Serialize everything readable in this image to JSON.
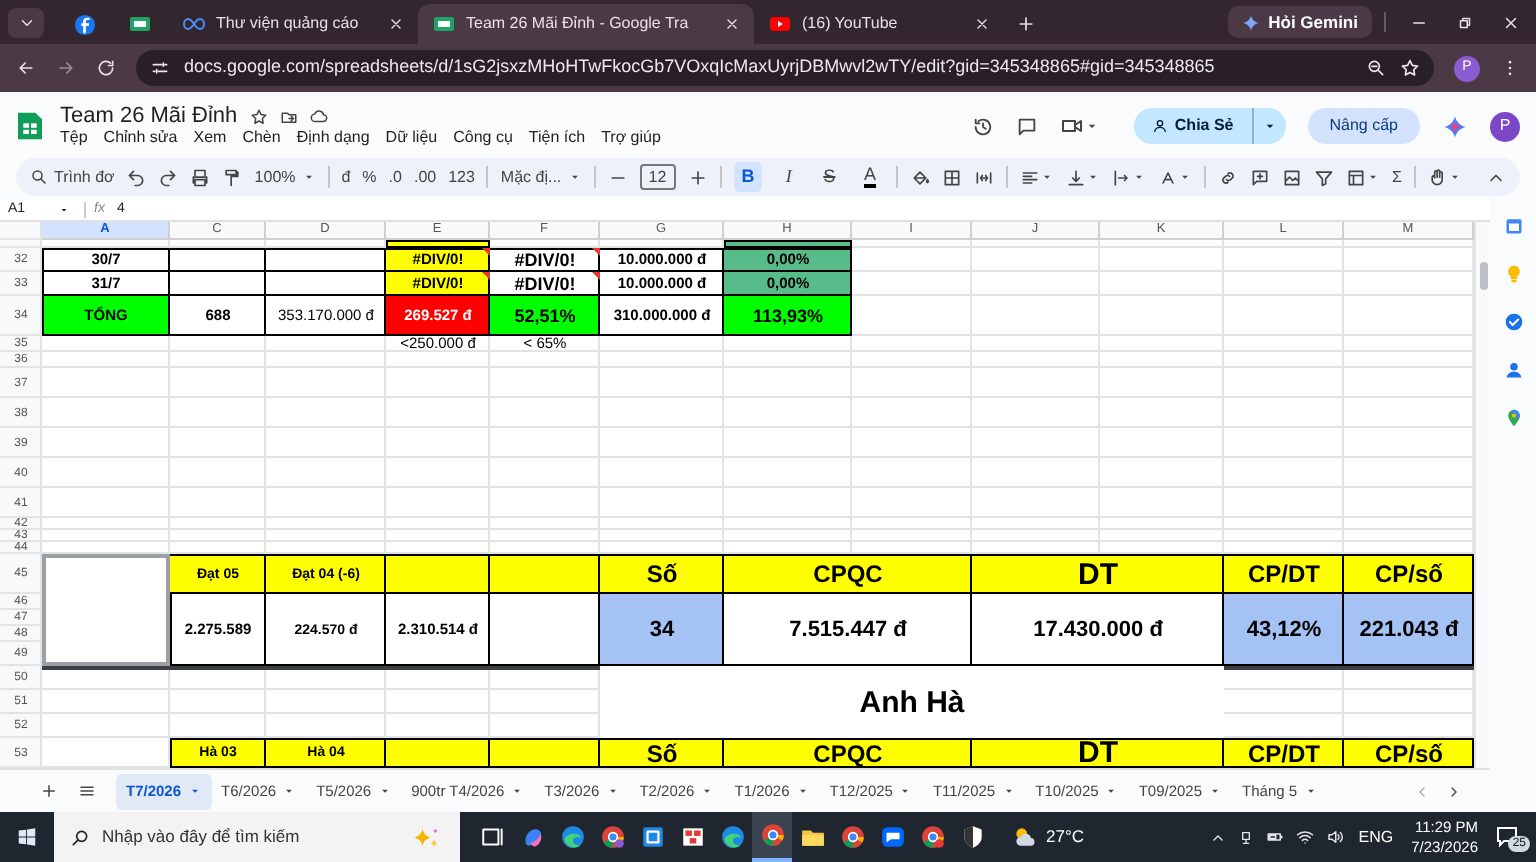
{
  "browser": {
    "tabs": [
      {
        "kind": "circle",
        "selected": false
      },
      {
        "kind": "sheet",
        "selected": false
      },
      {
        "kind": "loop",
        "title": "Thư viện quảng cáo",
        "selected": false
      },
      {
        "kind": "sheet",
        "title": "Team 26 Mãi Đỉnh - Google Tra",
        "selected": true
      },
      {
        "kind": "play",
        "title": "(16) YouTube",
        "selected": false
      }
    ],
    "gemini": "Hỏi Gemini",
    "url": "docs.google.com/spreadsheets/d/1sG2jsxzMHoHTwFkocGb7VOxqIcMaxUyrjDBMwvl2wTY/edit?gid=345348865#gid=345348865",
    "profile": "P"
  },
  "app": {
    "title": "Team 26 Mãi Đỉnh",
    "menu": [
      "Tệp",
      "Chỉnh sửa",
      "Xem",
      "Chèn",
      "Định dạng",
      "Dữ liệu",
      "Công cụ",
      "Tiện ích",
      "Trợ giúp"
    ],
    "share": "Chia Sẻ",
    "upgrade": "Nâng cấp",
    "avatar": "P"
  },
  "toolbar": [
    {
      "kind": "search",
      "text": "Trình đơ"
    },
    {
      "kind": "dropdown",
      "text": "100%"
    },
    {
      "kind": "button",
      "text": "đ"
    },
    {
      "kind": "button",
      "text": "%"
    },
    {
      "kind": "button",
      "text": ".0"
    },
    {
      "kind": "button",
      "text": ".00"
    },
    {
      "kind": "button",
      "text": "123"
    },
    {
      "kind": "dropdown",
      "text": "Mặc đị..."
    },
    {
      "kind": "field",
      "text": "12"
    },
    {
      "kind": "toggle",
      "text": "B",
      "selected": true
    },
    {
      "kind": "toggle",
      "text": "I",
      "selected": false
    },
    {
      "kind": "toggle",
      "text": "S",
      "selected": false
    },
    {
      "kind": "toggle",
      "text": "A",
      "selected": false
    },
    {
      "kind": "button",
      "text": "Σ"
    }
  ],
  "formula_bar": {
    "cell": "A1",
    "fx": "fx",
    "value": "4"
  },
  "sheet": {
    "columns": [
      {
        "label": "A",
        "selected": true
      },
      {
        "label": "C",
        "selected": false
      },
      {
        "label": "D",
        "selected": false
      },
      {
        "label": "E",
        "selected": false
      },
      {
        "label": "F",
        "selected": false
      },
      {
        "label": "G",
        "selected": false
      },
      {
        "label": "H",
        "selected": false
      },
      {
        "label": "I",
        "selected": false
      },
      {
        "label": "J",
        "selected": false
      },
      {
        "label": "K",
        "selected": false
      },
      {
        "label": "L",
        "selected": false
      },
      {
        "label": "M",
        "selected": false
      }
    ],
    "rows": [
      {
        "cells": [
          {
            "color": "#ffff00"
          },
          {
            "color": "#57bb8a"
          }
        ]
      },
      {
        "number": "32",
        "cells": [
          {
            "text": "30/7",
            "kind": "bold"
          },
          {},
          {},
          {
            "text": "#DIV/0!",
            "kind": "bold",
            "color": "#ffff00",
            "error": true
          },
          {
            "text": "#DIV/0!",
            "kind": "strong",
            "error": true
          },
          {
            "text": "10.000.000 đ",
            "kind": "bold"
          },
          {
            "text": "0,00%",
            "kind": "bold",
            "color": "#57bb8a"
          }
        ]
      },
      {
        "number": "33",
        "cells": [
          {
            "text": "31/7",
            "kind": "bold"
          },
          {},
          {},
          {
            "text": "#DIV/0!",
            "kind": "bold",
            "color": "#ffff00",
            "error": true
          },
          {
            "text": "#DIV/0!",
            "kind": "strong",
            "error": true
          },
          {
            "text": "10.000.000 đ",
            "kind": "bold"
          },
          {
            "text": "0,00%",
            "kind": "bold",
            "color": "#57bb8a"
          }
        ]
      },
      {
        "number": "34",
        "cells": [
          {
            "text": "TỔNG",
            "kind": "bold",
            "color": "#00ff00"
          },
          {
            "text": "688",
            "kind": "bold"
          },
          {
            "text": "353.170.000 đ",
            "kind": "plain"
          },
          {
            "text": "269.527 đ",
            "kind": "bold",
            "color": "#ff0000"
          },
          {
            "text": "52,51%",
            "kind": "strong",
            "color": "#00ff00"
          },
          {
            "text": "310.000.000 đ",
            "kind": "bold"
          },
          {
            "text": "113,93%",
            "kind": "strong",
            "color": "#00ff00"
          }
        ]
      },
      {
        "number": "35",
        "cells": [
          {
            "text": "<250.000 đ",
            "kind": "plain"
          },
          {
            "text": "< 65%",
            "kind": "plain"
          }
        ]
      },
      {
        "number": "36"
      },
      {
        "number": "37"
      },
      {
        "number": "38"
      },
      {
        "number": "39"
      },
      {
        "number": "40"
      },
      {
        "number": "41"
      },
      {
        "number": "42"
      },
      {
        "number": "43"
      },
      {
        "number": "44"
      },
      {
        "number": "45",
        "cells": [
          {},
          {
            "text": "Đạt 05",
            "kind": "tiny",
            "color": "#ffff00"
          },
          {
            "text": "Đạt 04 (-6)",
            "kind": "tiny",
            "color": "#ffff00"
          },
          {
            "color": "#ffff00"
          },
          {
            "color": "#ffff00"
          },
          {
            "text": "Số",
            "kind": "header",
            "color": "#ffff00"
          },
          {
            "text": "CPQC",
            "kind": "header",
            "color": "#ffff00"
          },
          {
            "text": "DT",
            "kind": "title",
            "color": "#ffff00"
          },
          {
            "text": "CP/DT",
            "kind": "header",
            "color": "#ffff00"
          },
          {
            "text": "CP/số",
            "kind": "header",
            "color": "#ffff00"
          }
        ]
      },
      {
        "number": "46",
        "cells": [
          {
            "text": "2.275.589",
            "kind": "small"
          },
          {
            "text": "224.570 đ",
            "kind": "tiny"
          },
          {
            "text": "2.310.514 đ",
            "kind": "small"
          },
          {},
          {
            "text": "34",
            "kind": "big",
            "color": "#a4c2f4"
          },
          {
            "text": "7.515.447 đ",
            "kind": "big"
          },
          {
            "text": "17.430.000 đ",
            "kind": "big"
          },
          {
            "text": "43,12%",
            "kind": "big",
            "color": "#a4c2f4"
          },
          {
            "text": "221.043 đ",
            "kind": "big",
            "color": "#a4c2f4"
          }
        ]
      },
      {
        "number": "47"
      },
      {
        "number": "48"
      },
      {
        "number": "49"
      },
      {
        "number": "50",
        "cells": [
          {
            "text": "Anh Hà",
            "kind": "title"
          }
        ]
      },
      {
        "number": "51"
      },
      {
        "number": "52"
      },
      {
        "number": "53",
        "cells": [
          {
            "text": "Hà 03",
            "kind": "tiny",
            "color": "#ffff00"
          },
          {
            "text": "Hà 04",
            "kind": "tiny",
            "color": "#ffff00"
          },
          {
            "color": "#ffff00"
          },
          {
            "color": "#ffff00"
          },
          {
            "text": "Số",
            "kind": "header",
            "color": "#ffff00"
          },
          {
            "text": "CPQC",
            "kind": "header",
            "color": "#ffff00"
          },
          {
            "text": "DT",
            "kind": "title",
            "color": "#ffff00"
          },
          {
            "text": "CP/DT",
            "kind": "header",
            "color": "#ffff00"
          },
          {
            "text": "CP/số",
            "kind": "header",
            "color": "#ffff00"
          }
        ]
      }
    ]
  },
  "sheet_tabs": [
    {
      "label": "T7/2026",
      "selected": true
    },
    {
      "label": "T6/2026",
      "selected": false
    },
    {
      "label": "T5/2026",
      "selected": false
    },
    {
      "label": "900tr T4/2026",
      "selected": false
    },
    {
      "label": "T3/2026",
      "selected": false
    },
    {
      "label": "T2/2026",
      "selected": false
    },
    {
      "label": "T1/2026",
      "selected": false
    },
    {
      "label": "T12/2025",
      "selected": false
    },
    {
      "label": "T11/2025",
      "selected": false
    },
    {
      "label": "T10/2025",
      "selected": false
    },
    {
      "label": "T09/2025",
      "selected": false
    },
    {
      "label": "Tháng 5",
      "selected": false
    }
  ],
  "taskbar": {
    "search_placeholder": "Nhập vào đây để tìm kiếm",
    "weather": "27°C",
    "language": "ENG",
    "time": "11:29 PM",
    "date": "7/23/2026",
    "notifications": "25"
  }
}
